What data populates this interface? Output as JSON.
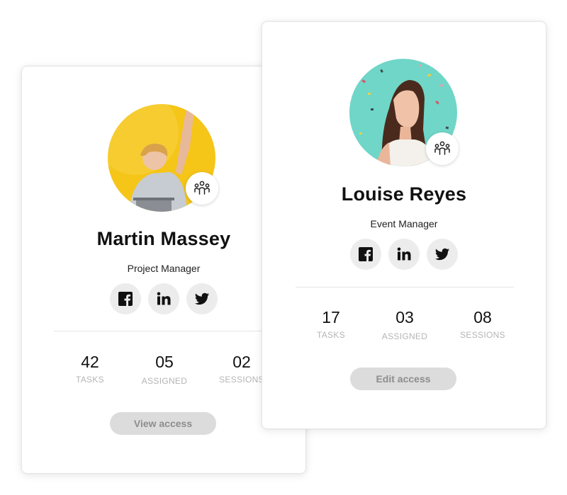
{
  "cards": {
    "martin": {
      "name": "Martin Massey",
      "role": "Project Manager",
      "avatar_bg": "#f5c518",
      "stats": [
        {
          "value": "42",
          "label": "TASKS"
        },
        {
          "value": "05",
          "label": "ASSIGNED"
        },
        {
          "value": "02",
          "label": "SESSIONS"
        }
      ],
      "button_label": "View access"
    },
    "louise": {
      "name": "Louise Reyes",
      "role": "Event Manager",
      "avatar_bg": "#6fd6c8",
      "stats": [
        {
          "value": "17",
          "label": "TASKS"
        },
        {
          "value": "03",
          "label": "ASSIGNED"
        },
        {
          "value": "08",
          "label": "SESSIONS"
        }
      ],
      "button_label": "Edit access"
    }
  },
  "icons": [
    "team-icon",
    "facebook-icon",
    "linkedin-icon",
    "twitter-icon"
  ],
  "colors": {
    "button_bg": "#dcdcdc",
    "button_text": "#8d8d8d",
    "label_gray": "#b5b5b5",
    "social_bg": "#ececec"
  }
}
